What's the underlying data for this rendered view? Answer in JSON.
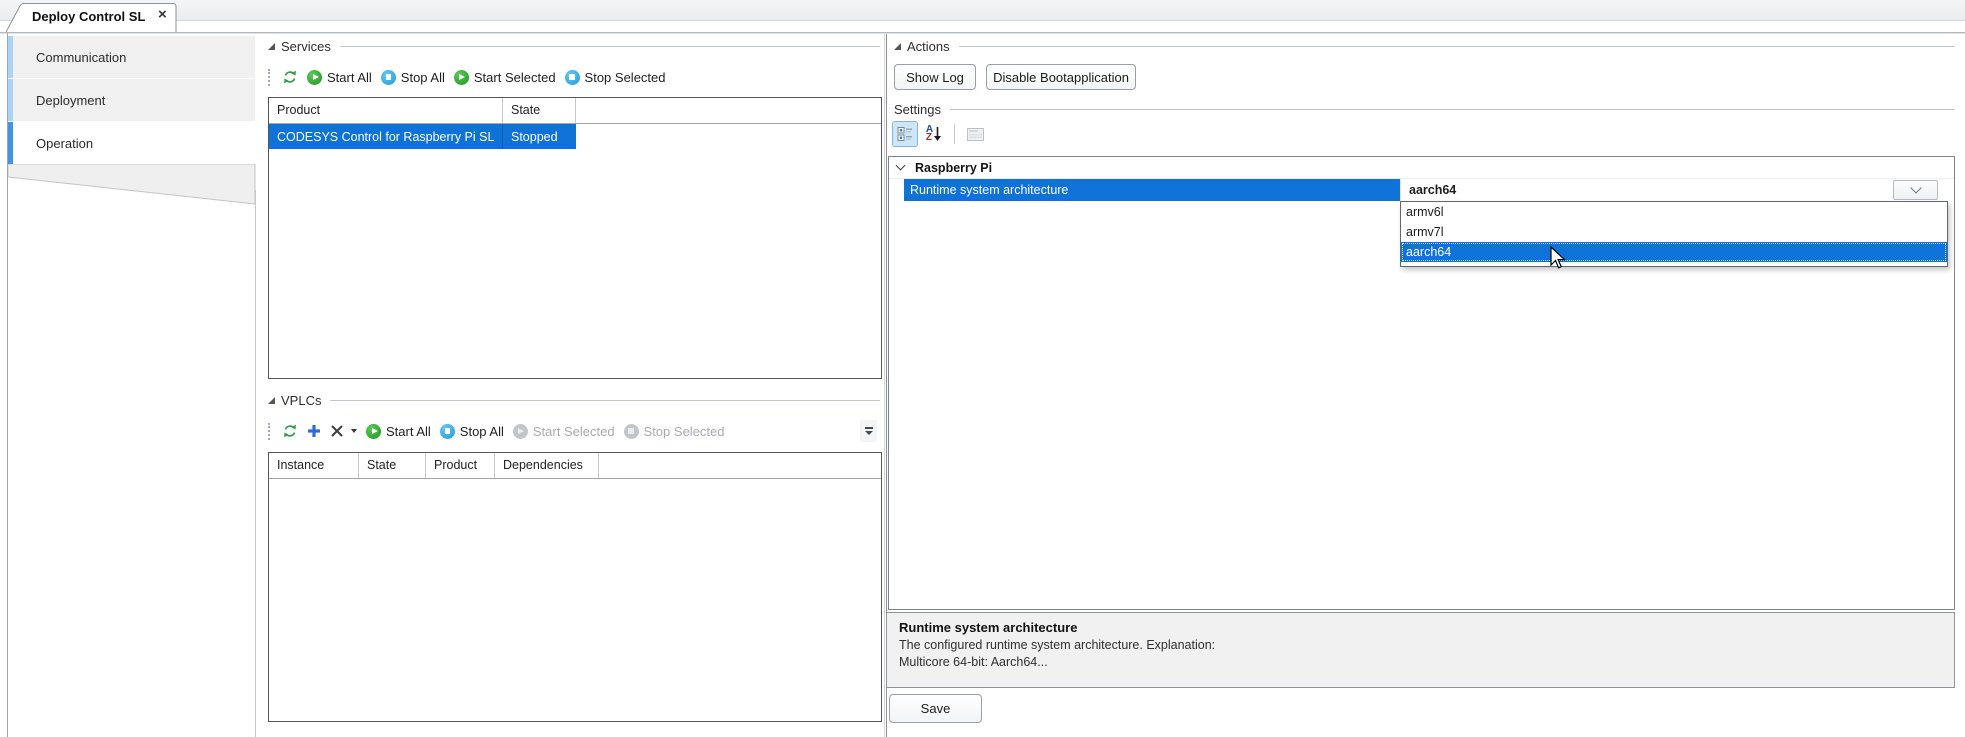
{
  "tab": {
    "title": "Deploy Control SL",
    "close_glyph": "×"
  },
  "sidebar": {
    "items": [
      {
        "label": "Communication",
        "selected": false
      },
      {
        "label": "Deployment",
        "selected": false
      },
      {
        "label": "Operation",
        "selected": true
      }
    ]
  },
  "services": {
    "title": "Services",
    "toolbar": {
      "start_all": "Start All",
      "stop_all": "Stop All",
      "start_selected": "Start Selected",
      "stop_selected": "Stop Selected"
    },
    "columns": {
      "product": "Product",
      "state": "State"
    },
    "row": {
      "product": "CODESYS Control for Raspberry Pi SL",
      "state": "Stopped",
      "selected": true
    }
  },
  "vplcs": {
    "title": "VPLCs",
    "toolbar": {
      "start_all": "Start All",
      "stop_all": "Stop All",
      "start_selected": "Start Selected",
      "stop_selected": "Stop Selected"
    },
    "columns": {
      "instance": "Instance",
      "state": "State",
      "product": "Product",
      "dependencies": "Dependencies"
    },
    "rows": []
  },
  "actions": {
    "title": "Actions",
    "show_log": "Show Log",
    "disable_boot": "Disable Bootapplication"
  },
  "settings": {
    "title": "Settings",
    "group_label": "Raspberry Pi",
    "property_name": "Runtime system architecture",
    "property_value": "aarch64",
    "dropdown": {
      "options": [
        "armv6l",
        "armv7l",
        "aarch64"
      ],
      "selected": "aarch64"
    },
    "help": {
      "title": "Runtime system architecture",
      "line1": "The configured runtime system architecture. Explanation:",
      "line2": "Multicore 64-bit: Aarch64..."
    },
    "save_label": "Save"
  },
  "icons": {
    "az_a": "A",
    "az_z": "Z"
  },
  "colors": {
    "selection": "#0e72d6",
    "start_green": "#23a127",
    "stop_blue": "#29abe2",
    "sidebar_accent": "#4094e8"
  }
}
